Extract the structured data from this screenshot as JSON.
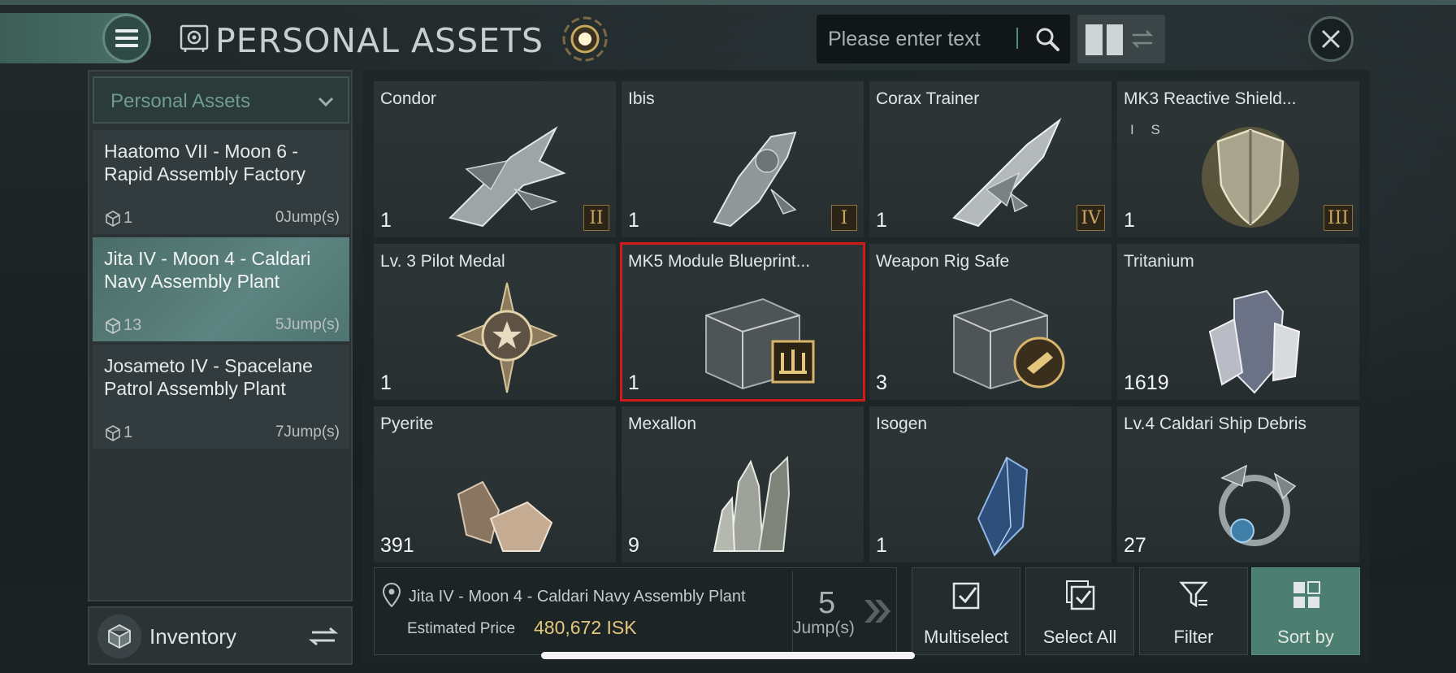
{
  "header": {
    "title": "PERSONAL ASSETS",
    "search_placeholder": "Please enter text",
    "icons": [
      "menu-icon",
      "safe-icon",
      "beacon-icon",
      "search-icon",
      "grid-view-icon",
      "swap-icon",
      "close-icon"
    ]
  },
  "sidebar": {
    "dropdown_label": "Personal Assets",
    "locations": [
      {
        "name": "Haatomo VII - Moon 6 - Rapid Assembly Factory",
        "count": "1",
        "jumps": "0Jump(s)",
        "active": false
      },
      {
        "name": "Jita IV - Moon 4 - Caldari Navy Assembly Plant",
        "count": "13",
        "jumps": "5Jump(s)",
        "active": true
      },
      {
        "name": "Josameto IV - Spacelane Patrol Assembly Plant",
        "count": "1",
        "jumps": "7Jump(s)",
        "active": false
      }
    ],
    "inventory_label": "Inventory"
  },
  "items": [
    {
      "name": "Condor",
      "qty": "1",
      "tier": "II"
    },
    {
      "name": "Ibis",
      "qty": "1",
      "tier": "I"
    },
    {
      "name": "Corax Trainer",
      "qty": "1",
      "tier": "IV"
    },
    {
      "name": "MK3 Reactive Shield...",
      "qty": "1",
      "tier": "III",
      "tags": "I S"
    },
    {
      "name": "Lv. 3 Pilot Medal",
      "qty": "1"
    },
    {
      "name": "MK5 Module Blueprint...",
      "qty": "1",
      "selected": true
    },
    {
      "name": "Weapon Rig Safe",
      "qty": "3"
    },
    {
      "name": "Tritanium",
      "qty": "1619"
    },
    {
      "name": "Pyerite",
      "qty": "391"
    },
    {
      "name": "Mexallon",
      "qty": "9"
    },
    {
      "name": "Isogen",
      "qty": "1"
    },
    {
      "name": "Lv.4 Caldari Ship Debris",
      "qty": "27"
    }
  ],
  "info": {
    "location": "Jita IV - Moon 4 - Caldari Navy Assembly Plant",
    "estimated_label": "Estimated Price",
    "estimated_value": "480,672 ISK",
    "jumps_number": "5",
    "jumps_label": "Jump(s)"
  },
  "actions": {
    "multiselect": "Multiselect",
    "select_all": "Select All",
    "filter": "Filter",
    "sort_by": "Sort by"
  },
  "colors": {
    "accent_teal": "#4c7f70",
    "selection_red": "#d11a1a",
    "price_gold": "#e4c77c",
    "tier_gold": "#c8a760"
  }
}
